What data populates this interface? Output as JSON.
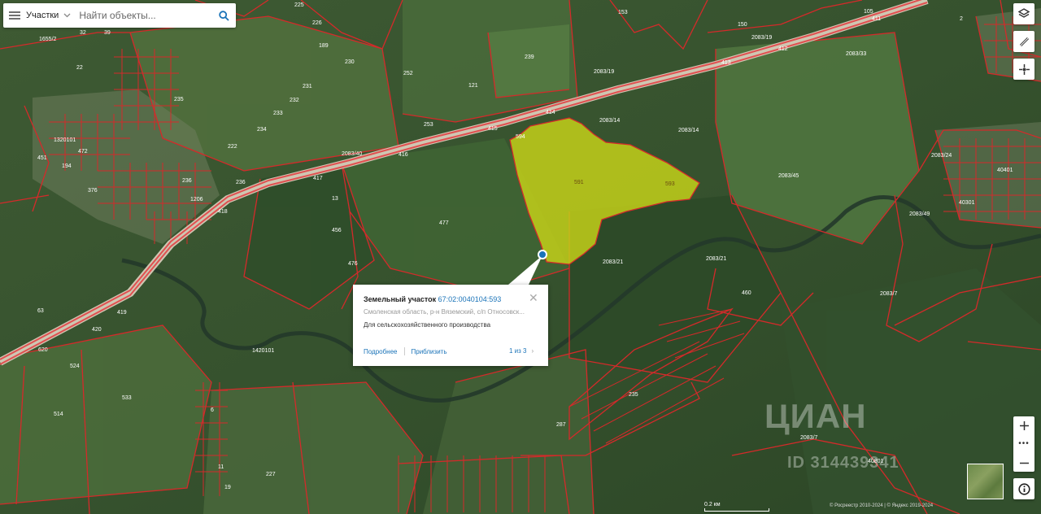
{
  "search": {
    "category_label": "Участки",
    "placeholder": "Найти объекты..."
  },
  "popup": {
    "title_prefix": "Земельный участок",
    "cadastral_number": "67:02:0040104:593",
    "address": "Смоленская область, р-н Вяземский, с/п Относовск...",
    "purpose": "Для сельскохозяйственного производства",
    "details_link": "Подробнее",
    "zoom_link": "Приблизить",
    "pager": "1 из 3"
  },
  "watermark": {
    "logo": "ЦИАН",
    "listing_id": "ID 314439341"
  },
  "scale_label": "0.2 км",
  "attribution": "© Росреестр 2010-2024 | © Яндекс 2019-2024",
  "highlight_color": "#c8d419",
  "boundary_color": "#d42a2a",
  "road_color": "#e05050",
  "map_labels": [
    {
      "t": "225"
    },
    {
      "t": "226"
    },
    {
      "t": "189"
    },
    {
      "t": "230"
    },
    {
      "t": "231"
    },
    {
      "t": "232"
    },
    {
      "t": "233"
    },
    {
      "t": "234"
    },
    {
      "t": "222"
    },
    {
      "t": "22"
    },
    {
      "t": "1655/2"
    },
    {
      "t": "32"
    },
    {
      "t": "39"
    },
    {
      "t": "235"
    },
    {
      "t": "1320101"
    },
    {
      "t": "194"
    },
    {
      "t": "451"
    },
    {
      "t": "472"
    },
    {
      "t": "376"
    },
    {
      "t": "252"
    },
    {
      "t": "121"
    },
    {
      "t": "253"
    },
    {
      "t": "239"
    },
    {
      "t": "153"
    },
    {
      "t": "150"
    },
    {
      "t": "105"
    },
    {
      "t": "411"
    },
    {
      "t": "2083/19"
    },
    {
      "t": "412"
    },
    {
      "t": "413"
    },
    {
      "t": "2083/19"
    },
    {
      "t": "2083/33"
    },
    {
      "t": "2"
    },
    {
      "t": "414"
    },
    {
      "t": "415"
    },
    {
      "t": "416"
    },
    {
      "t": "2083/40"
    },
    {
      "t": "417"
    },
    {
      "t": "594"
    },
    {
      "t": "2083/14"
    },
    {
      "t": "2083/14"
    },
    {
      "t": "591"
    },
    {
      "t": "593"
    },
    {
      "t": "2083/24"
    },
    {
      "t": "2083/45"
    },
    {
      "t": "40401"
    },
    {
      "t": "40301"
    },
    {
      "t": "2083/49"
    },
    {
      "t": "13"
    },
    {
      "t": "477"
    },
    {
      "t": "456"
    },
    {
      "t": "476"
    },
    {
      "t": "2083/21"
    },
    {
      "t": "2083/21"
    },
    {
      "t": "460"
    },
    {
      "t": "2083/7"
    },
    {
      "t": "419"
    },
    {
      "t": "420"
    },
    {
      "t": "620"
    },
    {
      "t": "63"
    },
    {
      "t": "1420101"
    },
    {
      "t": "524"
    },
    {
      "t": "533"
    },
    {
      "t": "514"
    },
    {
      "t": "287"
    },
    {
      "t": "235"
    },
    {
      "t": "2083/7"
    },
    {
      "t": "40801"
    },
    {
      "t": "227"
    },
    {
      "t": "6"
    },
    {
      "t": "11"
    },
    {
      "t": "19"
    },
    {
      "t": "1206"
    },
    {
      "t": "418"
    },
    {
      "t": "236"
    },
    {
      "t": "236"
    }
  ]
}
